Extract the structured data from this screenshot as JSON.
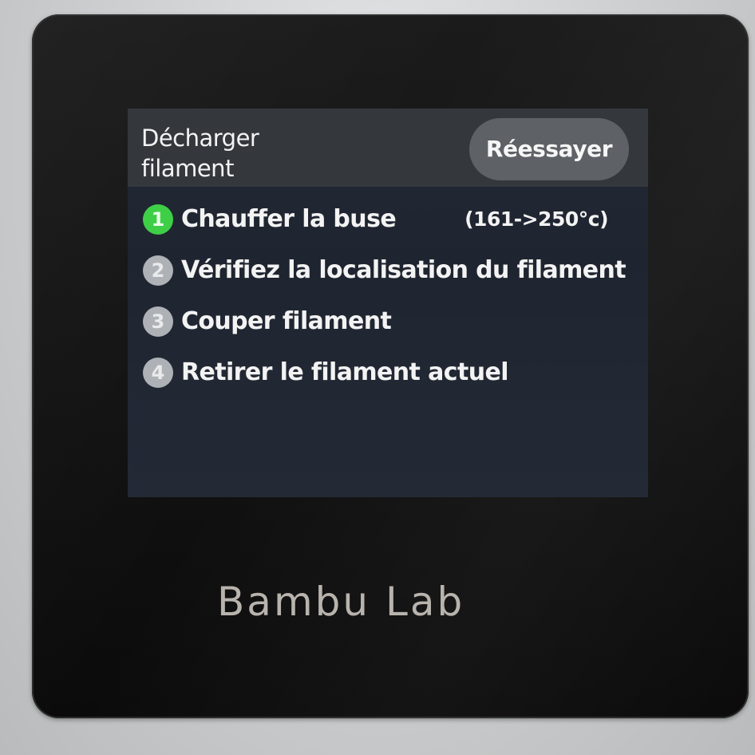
{
  "screen": {
    "title": "Décharger\nfilament",
    "retry_button": "Réessayer",
    "steps": [
      {
        "number": "1",
        "label": "Chauffer la buse",
        "extra": "(161->250°c)",
        "active": true
      },
      {
        "number": "2",
        "label": "Vérifiez la localisation du filament",
        "extra": "",
        "active": false
      },
      {
        "number": "3",
        "label": "Couper filament",
        "extra": "",
        "active": false
      },
      {
        "number": "4",
        "label": "Retirer le filament actuel",
        "extra": "",
        "active": false
      }
    ]
  },
  "device": {
    "brand": "Bambu Lab"
  },
  "colors": {
    "active_step": "#3fcf47",
    "inactive_step": "#aeb2b6",
    "header_bg": "#34383d",
    "button_bg": "#5e6166"
  }
}
